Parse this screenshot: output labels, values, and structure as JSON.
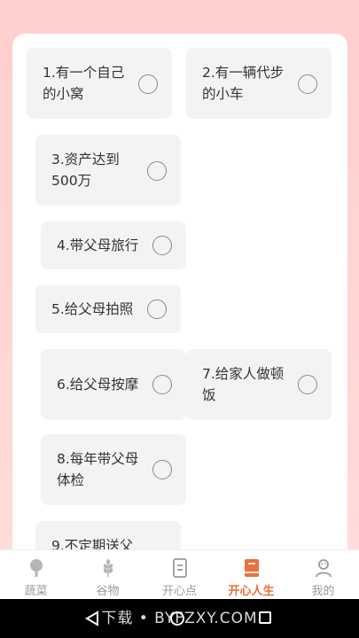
{
  "wishes": [
    {
      "label_line1": "1.有一个自己",
      "label_line2": "的小窝"
    },
    {
      "label_line1": "2.有一辆代步",
      "label_line2": "的小车"
    },
    {
      "label_line1": "3.资产达到",
      "label_line2": "500万"
    },
    {
      "label_line1": "4.带父母旅行",
      "label_line2": ""
    },
    {
      "label_line1": "5.给父母拍照",
      "label_line2": ""
    },
    {
      "label_line1": "6.给父母按摩",
      "label_line2": ""
    },
    {
      "label_line1": "7.给家人做顿",
      "label_line2": "饭"
    },
    {
      "label_line1": "8.每年带父母",
      "label_line2": "体检"
    },
    {
      "label_line1": "9.不定期送父",
      "label_line2": ""
    }
  ],
  "tabbar": {
    "items": [
      {
        "label": "蔬菜",
        "icon": "tree-icon"
      },
      {
        "label": "谷物",
        "icon": "wheat-icon"
      },
      {
        "label": "开心点",
        "icon": "document-icon"
      },
      {
        "label": "开心人生",
        "icon": "book-icon",
        "active": true
      },
      {
        "label": "我的",
        "icon": "person-icon"
      }
    ]
  },
  "watermark": "下载 • BYFZXY.COM",
  "colors": {
    "background": "#ffd2d0",
    "card": "#ffffff",
    "item_bg": "#f3f3f3",
    "active_tab": "#e8713c",
    "inactive_tab": "#9a9a9a"
  }
}
